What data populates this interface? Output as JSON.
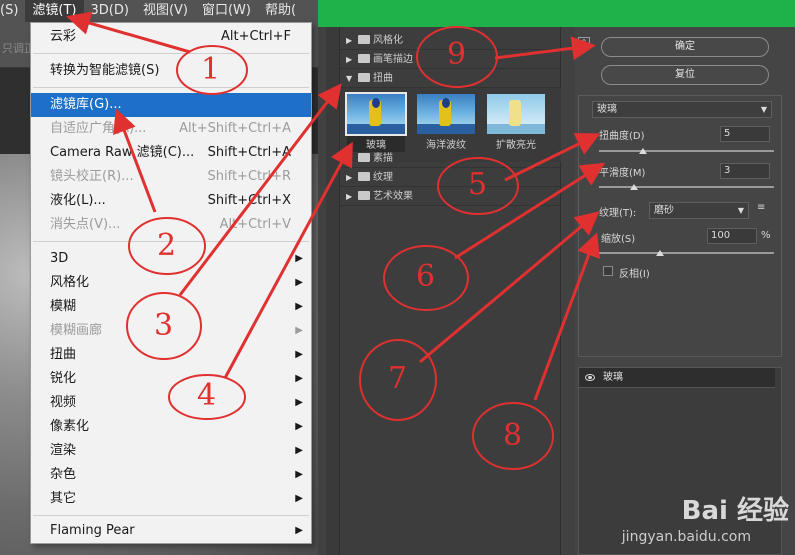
{
  "menubar": {
    "items": [
      {
        "label": "(S)"
      },
      {
        "label": "滤镜(T)"
      },
      {
        "label": "3D(D)"
      },
      {
        "label": "视图(V)"
      },
      {
        "label": "窗口(W)"
      },
      {
        "label": "帮助("
      }
    ]
  },
  "toolbar_hint": "只调正",
  "filter_menu": {
    "items": [
      {
        "label": "云彩",
        "shortcut": "Alt+Ctrl+F"
      },
      {
        "label": "转换为智能滤镜(S)"
      },
      {
        "label": "滤镜库(G)..."
      },
      {
        "label": "自适应广角(A)...",
        "shortcut": "Alt+Shift+Ctrl+A"
      },
      {
        "label": "Camera Raw 滤镜(C)...",
        "shortcut": "Shift+Ctrl+A"
      },
      {
        "label": "镜头校正(R)...",
        "shortcut": "Shift+Ctrl+R"
      },
      {
        "label": "液化(L)...",
        "shortcut": "Shift+Ctrl+X"
      },
      {
        "label": "消失点(V)...",
        "shortcut": "Alt+Ctrl+V"
      },
      {
        "label": "3D"
      },
      {
        "label": "风格化"
      },
      {
        "label": "模糊"
      },
      {
        "label": "模糊画廊"
      },
      {
        "label": "扭曲"
      },
      {
        "label": "锐化"
      },
      {
        "label": "视频"
      },
      {
        "label": "像素化"
      },
      {
        "label": "渲染"
      },
      {
        "label": "杂色"
      },
      {
        "label": "其它"
      },
      {
        "label": "Flaming Pear"
      }
    ]
  },
  "gallery": {
    "categories": [
      "风格化",
      "画笔描边",
      "扭曲",
      "素描",
      "纹理",
      "艺术效果"
    ],
    "thumbs": [
      "玻璃",
      "海洋波纹",
      "扩散亮光"
    ],
    "ok_label": "确定",
    "reset_label": "复位",
    "collapse_glyph": "⌃"
  },
  "settings": {
    "filter": "玻璃",
    "distortion_label": "扭曲度(D)",
    "distortion_value": "5",
    "distortion_level": 0.25,
    "smoothness_label": "平滑度(M)",
    "smoothness_value": "3",
    "smoothness_level": 0.2,
    "texture_label": "纹理(T):",
    "texture_value": "磨砂",
    "scale_label": "缩放(S)",
    "scale_value": "100",
    "scale_unit": "%",
    "scale_level": 0.35,
    "invert_label": "反相(I)",
    "layer_name": "玻璃"
  },
  "annotations": [
    "1",
    "2",
    "3",
    "4",
    "5",
    "6",
    "7",
    "8",
    "9"
  ],
  "watermark": {
    "brand": "Bai 经验",
    "url": "jingyan.baidu.com"
  },
  "colors": {
    "accent_red": "#e03030",
    "title_green": "#1fb24a",
    "highlight_blue": "#1e6fc8"
  }
}
